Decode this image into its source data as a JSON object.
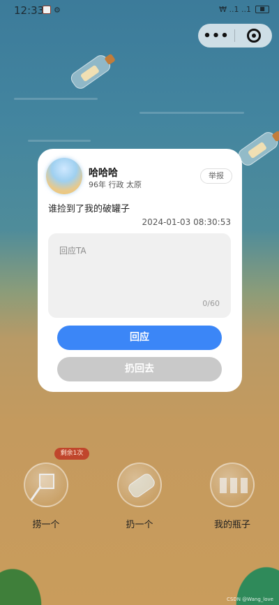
{
  "status_bar": {
    "time": "12:33",
    "right": "₩ ..1 ..1"
  },
  "capsule": {
    "menu": "•••",
    "close": "close"
  },
  "card": {
    "user_name": "哈哈哈",
    "user_meta": "96年 行政 太原",
    "report_label": "举报",
    "message": "谁捡到了我的破罐子",
    "timestamp": "2024-01-03 08:30:53",
    "reply_placeholder": "回应TA",
    "reply_count": "0/60",
    "primary_button": "回应",
    "secondary_button": "扔回去"
  },
  "actions": {
    "remaining_badge": "剩余1次",
    "items": [
      {
        "label": "捞一个",
        "icon": "net-icon"
      },
      {
        "label": "扔一个",
        "icon": "bottle-icon"
      },
      {
        "label": "我的瓶子",
        "icon": "jars-icon"
      }
    ]
  },
  "watermark": "CSDN @Wang_love",
  "colors": {
    "primary": "#3b86f7",
    "secondary": "#c9c9c9",
    "badge": "#c0462c"
  }
}
